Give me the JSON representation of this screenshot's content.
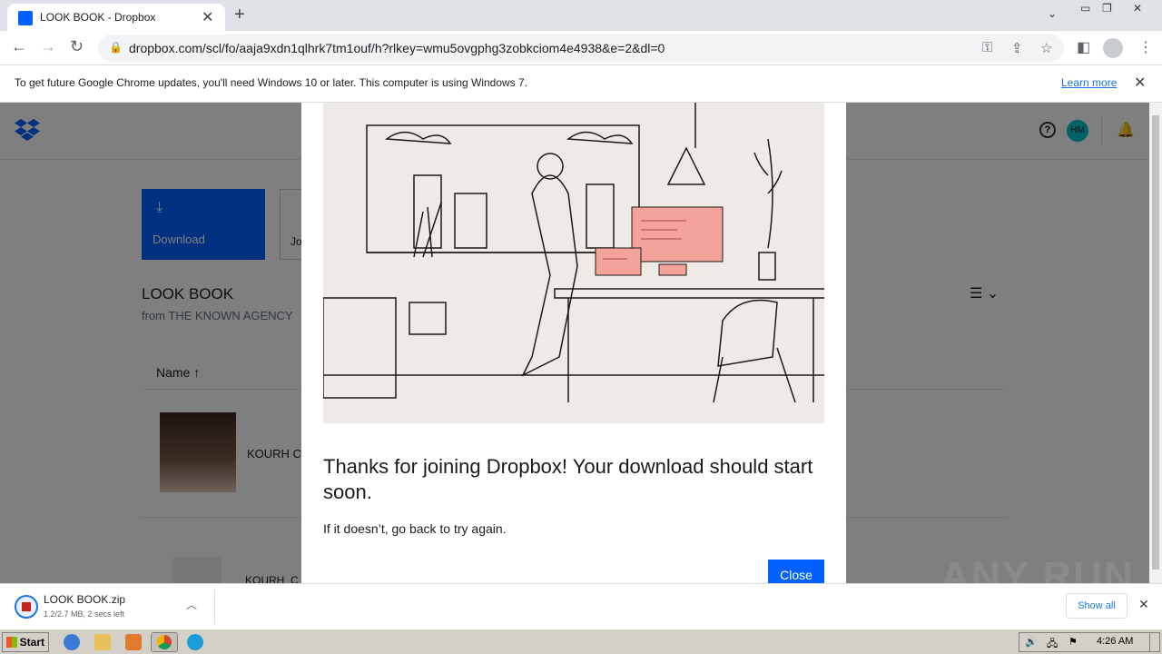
{
  "browser": {
    "tab_title": "LOOK BOOK - Dropbox",
    "url": "dropbox.com/scl/fo/aaja9xdn1qlhrk7tm1ouf/h?rlkey=wmu5ovgphg3zobkciom4e4938&e=2&dl=0",
    "infobar_message": "To get future Google Chrome updates, you'll need Windows 10 or later. This computer is using Windows 7.",
    "infobar_link": "Learn more"
  },
  "dropbox": {
    "avatar_initials": "HM",
    "download_label": "Download",
    "join_label": "Jo",
    "folder_title": "LOOK BOOK",
    "folder_owner": "from THE KNOWN AGENCY",
    "column_name": "Name",
    "files": [
      {
        "name": "KOURH C"
      },
      {
        "name": "KOURH_C"
      }
    ]
  },
  "modal": {
    "title": "Thanks for joining Dropbox! Your download should start soon.",
    "text": "If it doesn’t, go back to try again.",
    "close_label": "Close"
  },
  "downloads": {
    "file_name": "LOOK BOOK.zip",
    "status": "1.2/2.7 MB, 2 secs left",
    "show_all": "Show all"
  },
  "watermark": "ANY RUN",
  "taskbar": {
    "start_label": "Start",
    "clock": "4:26 AM"
  },
  "colors": {
    "dropbox_blue": "#0061fe",
    "avatar_teal": "#00c7d1"
  }
}
